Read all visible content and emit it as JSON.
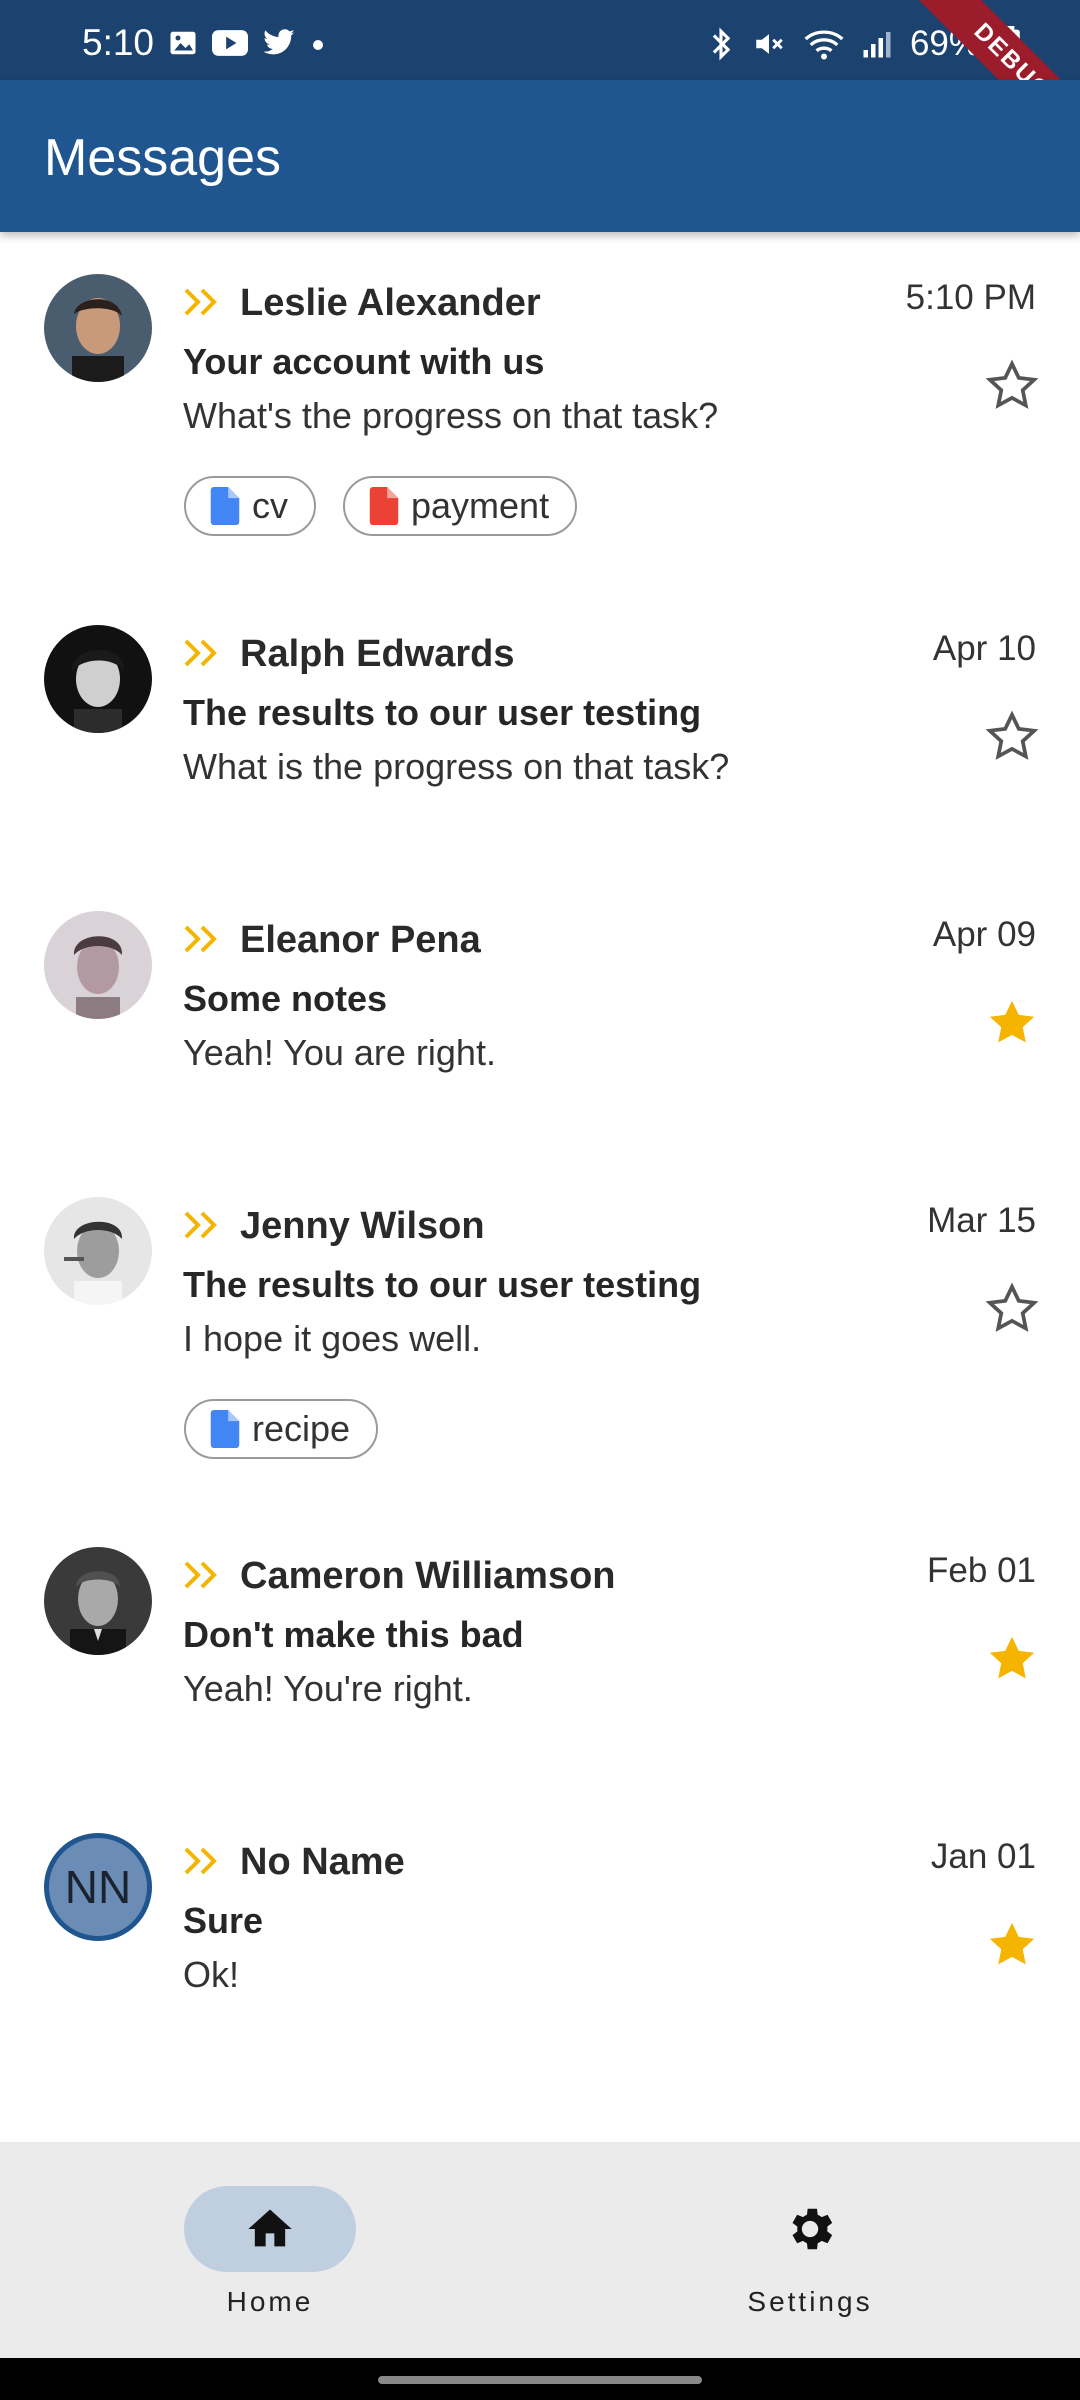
{
  "status_bar": {
    "time": "5:10",
    "battery": "69%",
    "debug_label": "DEBUG",
    "icons_left": [
      "image-icon",
      "youtube-icon",
      "twitter-icon",
      "dot-icon"
    ],
    "icons_right": [
      "bluetooth-icon",
      "mute-icon",
      "wifi-icon",
      "signal-icon",
      "battery-icon"
    ]
  },
  "app_bar": {
    "title": "Messages"
  },
  "colors": {
    "accent": "#1f5690",
    "star": "#f5b400",
    "chevron": "#f5b400",
    "doc_blue": "#4285f4",
    "doc_red": "#ea4335"
  },
  "messages": [
    {
      "sender": "Leslie Alexander",
      "date": "5:10 PM",
      "subject": "Your account with us",
      "preview": "What's the progress on that task?",
      "starred": false,
      "chips": [
        "cv",
        "payment"
      ]
    },
    {
      "sender": "Ralph Edwards",
      "date": "Apr 10",
      "subject": "The results to our user testing",
      "preview": "What is the progress on that task?",
      "starred": false,
      "chips": []
    },
    {
      "sender": "Eleanor Pena",
      "date": "Apr 09",
      "subject": "Some notes",
      "preview": "Yeah! You are right.",
      "starred": true,
      "chips": []
    },
    {
      "sender": "Jenny Wilson",
      "date": "Mar 15",
      "subject": "The results to our user testing",
      "preview": "I hope it goes well.",
      "starred": false,
      "chips": [
        "recipe"
      ]
    },
    {
      "sender": "Cameron Williamson",
      "date": "Feb 01",
      "subject": "Don't make this bad",
      "preview": "Yeah! You're right.",
      "starred": true,
      "chips": []
    },
    {
      "sender": "No Name",
      "date": "Jan 01",
      "subject": "Sure",
      "preview": "Ok!",
      "starred": true,
      "chips": [],
      "initials": "NN"
    }
  ],
  "bottom_nav": {
    "home_label": "Home",
    "settings_label": "Settings",
    "active": "Home"
  }
}
